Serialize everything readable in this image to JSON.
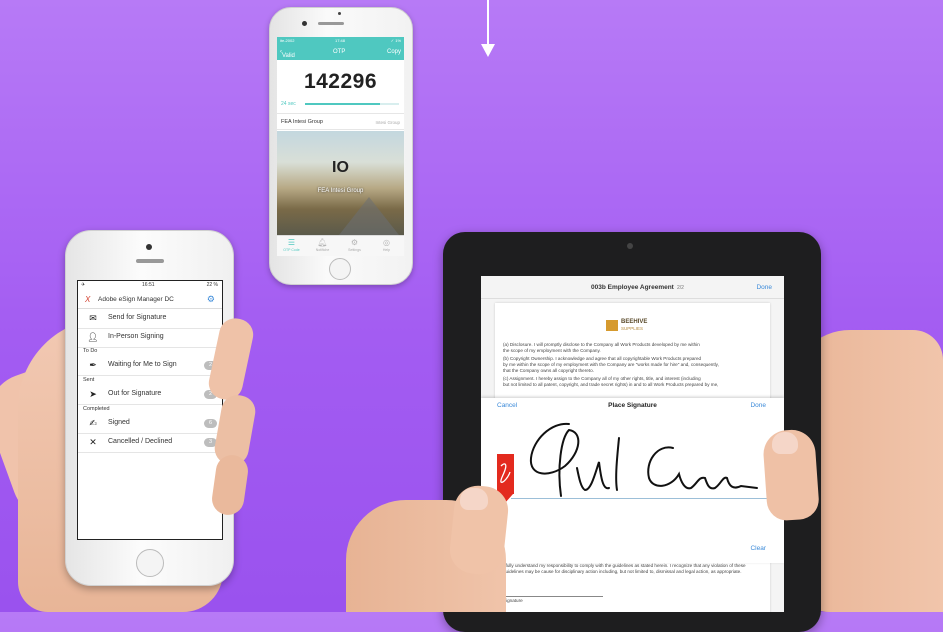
{
  "otp_phone": {
    "status": {
      "left": "ite-2002",
      "center": "17:48",
      "right": "✓ 1%"
    },
    "nav": {
      "back_label": "Valid",
      "title": "OTP",
      "action_label": "Copy"
    },
    "code": "142296",
    "timer_label": "24 sec",
    "timer_fraction": 0.8,
    "account_name": "FEA Intesi Group",
    "account_issuer": "Intesi Group",
    "hero_logo": "IO",
    "hero_caption": "FEA Intesi Group",
    "tabs": [
      {
        "label": "OTP Code",
        "icon": "menu-icon"
      },
      {
        "label": "Notifiche",
        "icon": "bell-icon"
      },
      {
        "label": "Settings",
        "icon": "gear-icon"
      },
      {
        "label": "Help",
        "icon": "help-icon"
      }
    ]
  },
  "esign_phone": {
    "status": {
      "time": "16:51",
      "battery": "22 %"
    },
    "app_title": "Adobe eSign Manager DC",
    "actions": [
      {
        "label": "Send for Signature",
        "icon": "envelope-icon"
      },
      {
        "label": "In-Person Signing",
        "icon": "person-icon"
      }
    ],
    "sections": [
      {
        "title": "To Do",
        "rows": [
          {
            "label": "Waiting for Me to Sign",
            "badge": "2",
            "icon": "pen-icon"
          }
        ]
      },
      {
        "title": "Sent",
        "rows": [
          {
            "label": "Out for Signature",
            "badge": "2",
            "icon": "send-icon"
          }
        ]
      },
      {
        "title": "Completed",
        "rows": [
          {
            "label": "Signed",
            "badge": "6",
            "icon": "signed-icon"
          },
          {
            "label": "Cancelled / Declined",
            "badge": "3",
            "icon": "x-icon"
          }
        ]
      }
    ]
  },
  "tablet": {
    "doc_title": "003b Employee Agreement",
    "page_indicator": "2/2",
    "done_label": "Done",
    "company_name": "BEEHIVE",
    "company_sub": "SUPPLIES",
    "doc_lines": [
      "(a)          Disclosure.  I will promptly disclose to the Company all Work Products developed by me within",
      "the scope of my employment with the Company.",
      "(b)          Copyright Ownership.  I acknowledge and agree that all copyrightable Work Products prepared",
      "by me within the scope of my employment with the Company are \"works made for hire\" and, consequently,",
      "that the Company owns all copyright thereto.",
      "(c)          Assignment.  I hereby assign to the Company all of my other rights, title, and interest (including",
      "but not limited to all patent, copyright, and trade secret rights) in and to all Work Products prepared by me,"
    ],
    "sheet": {
      "cancel": "Cancel",
      "title": "Place Signature",
      "done": "Done",
      "clear": "Clear"
    },
    "doc_below": "I fully understand my responsibility to comply with the guidelines as stated herein.  I recognize that any violation of these guidelines may be cause for disciplinary action including, but not limited to, dismissal and legal action, as appropriate.",
    "signature_label": "Signature"
  },
  "colors": {
    "background": "#a35cf2",
    "otp_accent": "#4fc8c0",
    "link_blue": "#3b8ad9",
    "acrobat_red": "#e32a1e"
  }
}
